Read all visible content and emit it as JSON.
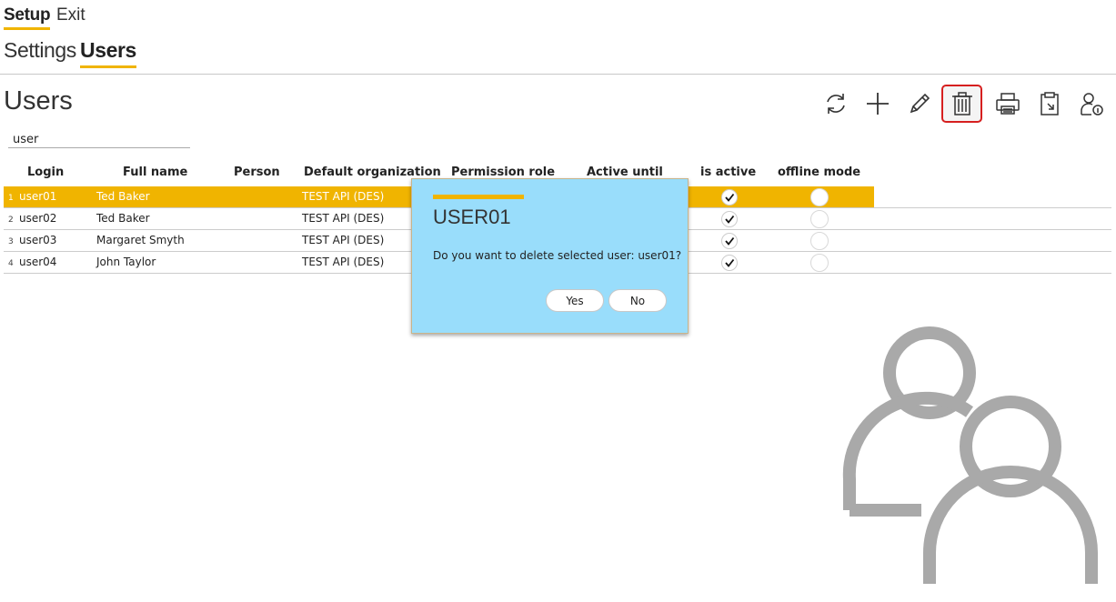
{
  "nav": {
    "top": {
      "setup": "Setup",
      "exit": "Exit"
    },
    "sub": {
      "settings": "Settings",
      "users": "Users"
    }
  },
  "page": {
    "title": "Users"
  },
  "toolbar": {
    "buttons": [
      "refresh-icon",
      "add-icon",
      "edit-icon",
      "delete-icon",
      "print-icon",
      "export-icon",
      "user-info-icon"
    ],
    "active": "delete-icon"
  },
  "search": {
    "value": "user",
    "placeholder": ""
  },
  "table": {
    "columns": [
      "Login",
      "Full name",
      "Person",
      "Default organization",
      "Permission role",
      "Active until",
      "is active",
      "offline mode"
    ],
    "rows": [
      {
        "num": "1",
        "login": "user01",
        "full_name": "Ted Baker",
        "person": "",
        "org": "TEST API (DES)",
        "is_active": true,
        "offline": false,
        "selected": true
      },
      {
        "num": "2",
        "login": "user02",
        "full_name": "Ted Baker",
        "person": "",
        "org": "TEST API (DES)",
        "is_active": true,
        "offline": false,
        "selected": false
      },
      {
        "num": "3",
        "login": "user03",
        "full_name": "Margaret Smyth",
        "person": "",
        "org": "TEST API (DES)",
        "is_active": true,
        "offline": false,
        "selected": false
      },
      {
        "num": "4",
        "login": "user04",
        "full_name": "John Taylor",
        "person": "",
        "org": "TEST API (DES)",
        "is_active": true,
        "offline": false,
        "selected": false
      }
    ]
  },
  "dialog": {
    "title": "USER01",
    "message": "Do you want to delete selected user: user01?",
    "yes_label": "Yes",
    "no_label": "No"
  },
  "colors": {
    "accent": "#f0b400",
    "dialog_bg": "#99ddfb",
    "active_outline": "#d61f1f",
    "illustration": "#a9a9a9"
  }
}
